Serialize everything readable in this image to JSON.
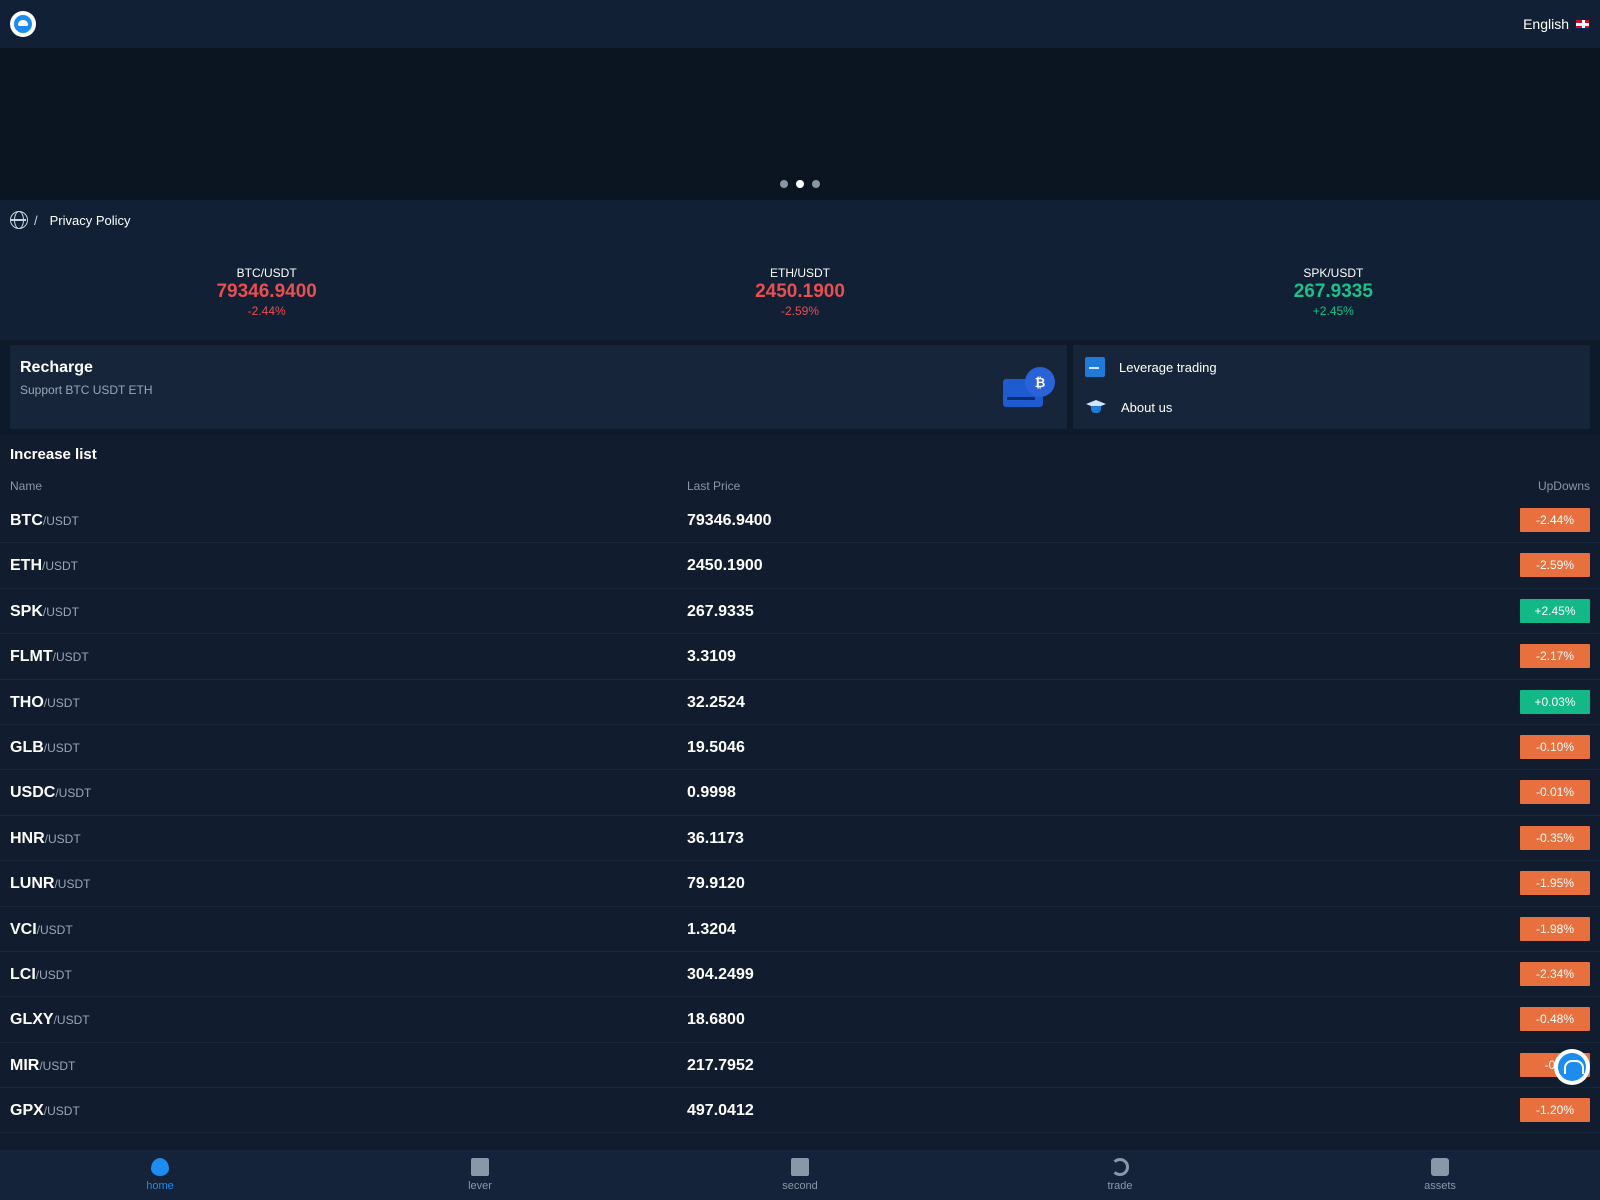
{
  "header": {
    "logo_icon": "dolphin-logo-icon",
    "language": "English",
    "flag_icon": "uk-flag-icon"
  },
  "banner": {
    "dots": 3,
    "active_dot": 2
  },
  "notice": {
    "icon": "globe-icon",
    "separator": "/",
    "text": "Privacy Policy"
  },
  "tickers": [
    {
      "pair": "BTC/USDT",
      "price": "79346.9400",
      "change": "-2.44%",
      "trend": "down"
    },
    {
      "pair": "ETH/USDT",
      "price": "2450.1900",
      "change": "-2.59%",
      "trend": "down"
    },
    {
      "pair": "SPK/USDT",
      "price": "267.9335",
      "change": "+2.45%",
      "trend": "up"
    }
  ],
  "recharge": {
    "title": "Recharge",
    "subtitle": "Support BTC USDT ETH",
    "coin_symbol": "₿"
  },
  "links": [
    {
      "label": "Leverage trading",
      "icon": "document-icon"
    },
    {
      "label": "About us",
      "icon": "graduation-cap-icon"
    }
  ],
  "list": {
    "title": "Increase list",
    "col_name": "Name",
    "col_price": "Last Price",
    "col_change": "UpDowns",
    "rows": [
      {
        "base": "BTC",
        "quote": "/USDT",
        "price": "79346.9400",
        "change": "-2.44%",
        "trend": "down"
      },
      {
        "base": "ETH",
        "quote": "/USDT",
        "price": "2450.1900",
        "change": "-2.59%",
        "trend": "down"
      },
      {
        "base": "SPK",
        "quote": "/USDT",
        "price": "267.9335",
        "change": "+2.45%",
        "trend": "up"
      },
      {
        "base": "FLMT",
        "quote": "/USDT",
        "price": "3.3109",
        "change": "-2.17%",
        "trend": "down"
      },
      {
        "base": "THO",
        "quote": "/USDT",
        "price": "32.2524",
        "change": "+0.03%",
        "trend": "up"
      },
      {
        "base": "GLB",
        "quote": "/USDT",
        "price": "19.5046",
        "change": "-0.10%",
        "trend": "down"
      },
      {
        "base": "USDC",
        "quote": "/USDT",
        "price": "0.9998",
        "change": "-0.01%",
        "trend": "down"
      },
      {
        "base": "HNR",
        "quote": "/USDT",
        "price": "36.1173",
        "change": "-0.35%",
        "trend": "down"
      },
      {
        "base": "LUNR",
        "quote": "/USDT",
        "price": "79.9120",
        "change": "-1.95%",
        "trend": "down"
      },
      {
        "base": "VCI",
        "quote": "/USDT",
        "price": "1.3204",
        "change": "-1.98%",
        "trend": "down"
      },
      {
        "base": "LCI",
        "quote": "/USDT",
        "price": "304.2499",
        "change": "-2.34%",
        "trend": "down"
      },
      {
        "base": "GLXY",
        "quote": "/USDT",
        "price": "18.6800",
        "change": "-0.48%",
        "trend": "down"
      },
      {
        "base": "MIR",
        "quote": "/USDT",
        "price": "217.7952",
        "change": "-0.6",
        "trend": "down"
      },
      {
        "base": "GPX",
        "quote": "/USDT",
        "price": "497.0412",
        "change": "-1.20%",
        "trend": "down"
      }
    ]
  },
  "support_icon": "customer-service-icon",
  "tabbar": [
    {
      "label": "home",
      "icon": "flame-icon",
      "active": true
    },
    {
      "label": "lever",
      "icon": "document-icon",
      "active": false
    },
    {
      "label": "second",
      "icon": "document-icon",
      "active": false
    },
    {
      "label": "trade",
      "icon": "sync-icon",
      "active": false
    },
    {
      "label": "assets",
      "icon": "wallet-icon",
      "active": false
    }
  ],
  "colors": {
    "background": "#111d2e",
    "down": "#e8703e",
    "up": "#12b886",
    "accent": "#1d8cf0"
  }
}
